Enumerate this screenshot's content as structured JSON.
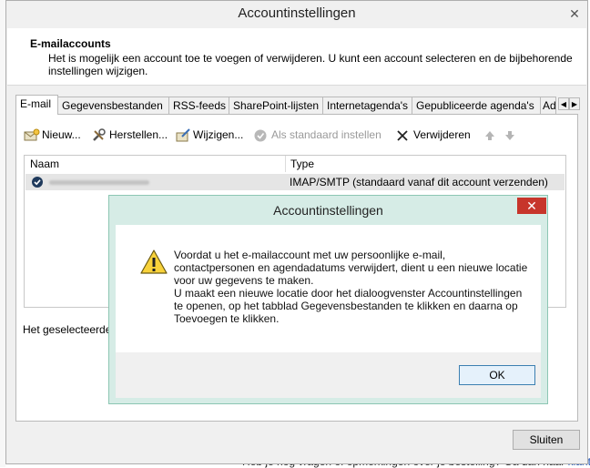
{
  "window": {
    "title": "Accountinstellingen",
    "close_glyph": "✕"
  },
  "header": {
    "title": "E-mailaccounts",
    "description": "Het is mogelijk een account toe te voegen of verwijderen. U kunt een account selecteren en de bijbehorende instellingen wijzigen."
  },
  "tabs": [
    {
      "label": "E-mail",
      "active": true
    },
    {
      "label": "Gegevensbestanden"
    },
    {
      "label": "RSS-feeds"
    },
    {
      "label": "SharePoint-lijsten"
    },
    {
      "label": "Internetagenda's"
    },
    {
      "label": "Gepubliceerde agenda's"
    },
    {
      "label": "Ad"
    }
  ],
  "toolbar": {
    "new": "Nieuw...",
    "repair": "Herstellen...",
    "change": "Wijzigen...",
    "set_default": "Als standaard instellen",
    "remove": "Verwijderen"
  },
  "list": {
    "col_name": "Naam",
    "col_type": "Type",
    "rows": [
      {
        "type": "IMAP/SMTP (standaard vanaf dit account verzenden)"
      }
    ]
  },
  "selected_label": "Het geselecteerde",
  "close_button": "Sluiten",
  "modal": {
    "title": "Accountinstellingen",
    "close_glyph": "✕",
    "message_1": "Voordat u het e-mailaccount met uw persoonlijke e-mail, contactpersonen en agendadatums verwijdert, dient u een nieuwe locatie voor uw gegevens te maken.",
    "message_2": "U maakt een nieuwe locatie door het dialoogvenster Accountinstellingen te openen, op het tabblad Gegevensbestanden te klikken en daarna op Toevoegen te klikken.",
    "ok": "OK"
  },
  "background": {
    "bottom_text": "Heb je nog vragen of opmerkingen over je bestelling? Ga dan naar",
    "bottom_link": "klanten"
  },
  "colors": {
    "modal_frame": "#d6ece6",
    "close_red": "#c7352b",
    "ok_border": "#3c7fb1"
  }
}
